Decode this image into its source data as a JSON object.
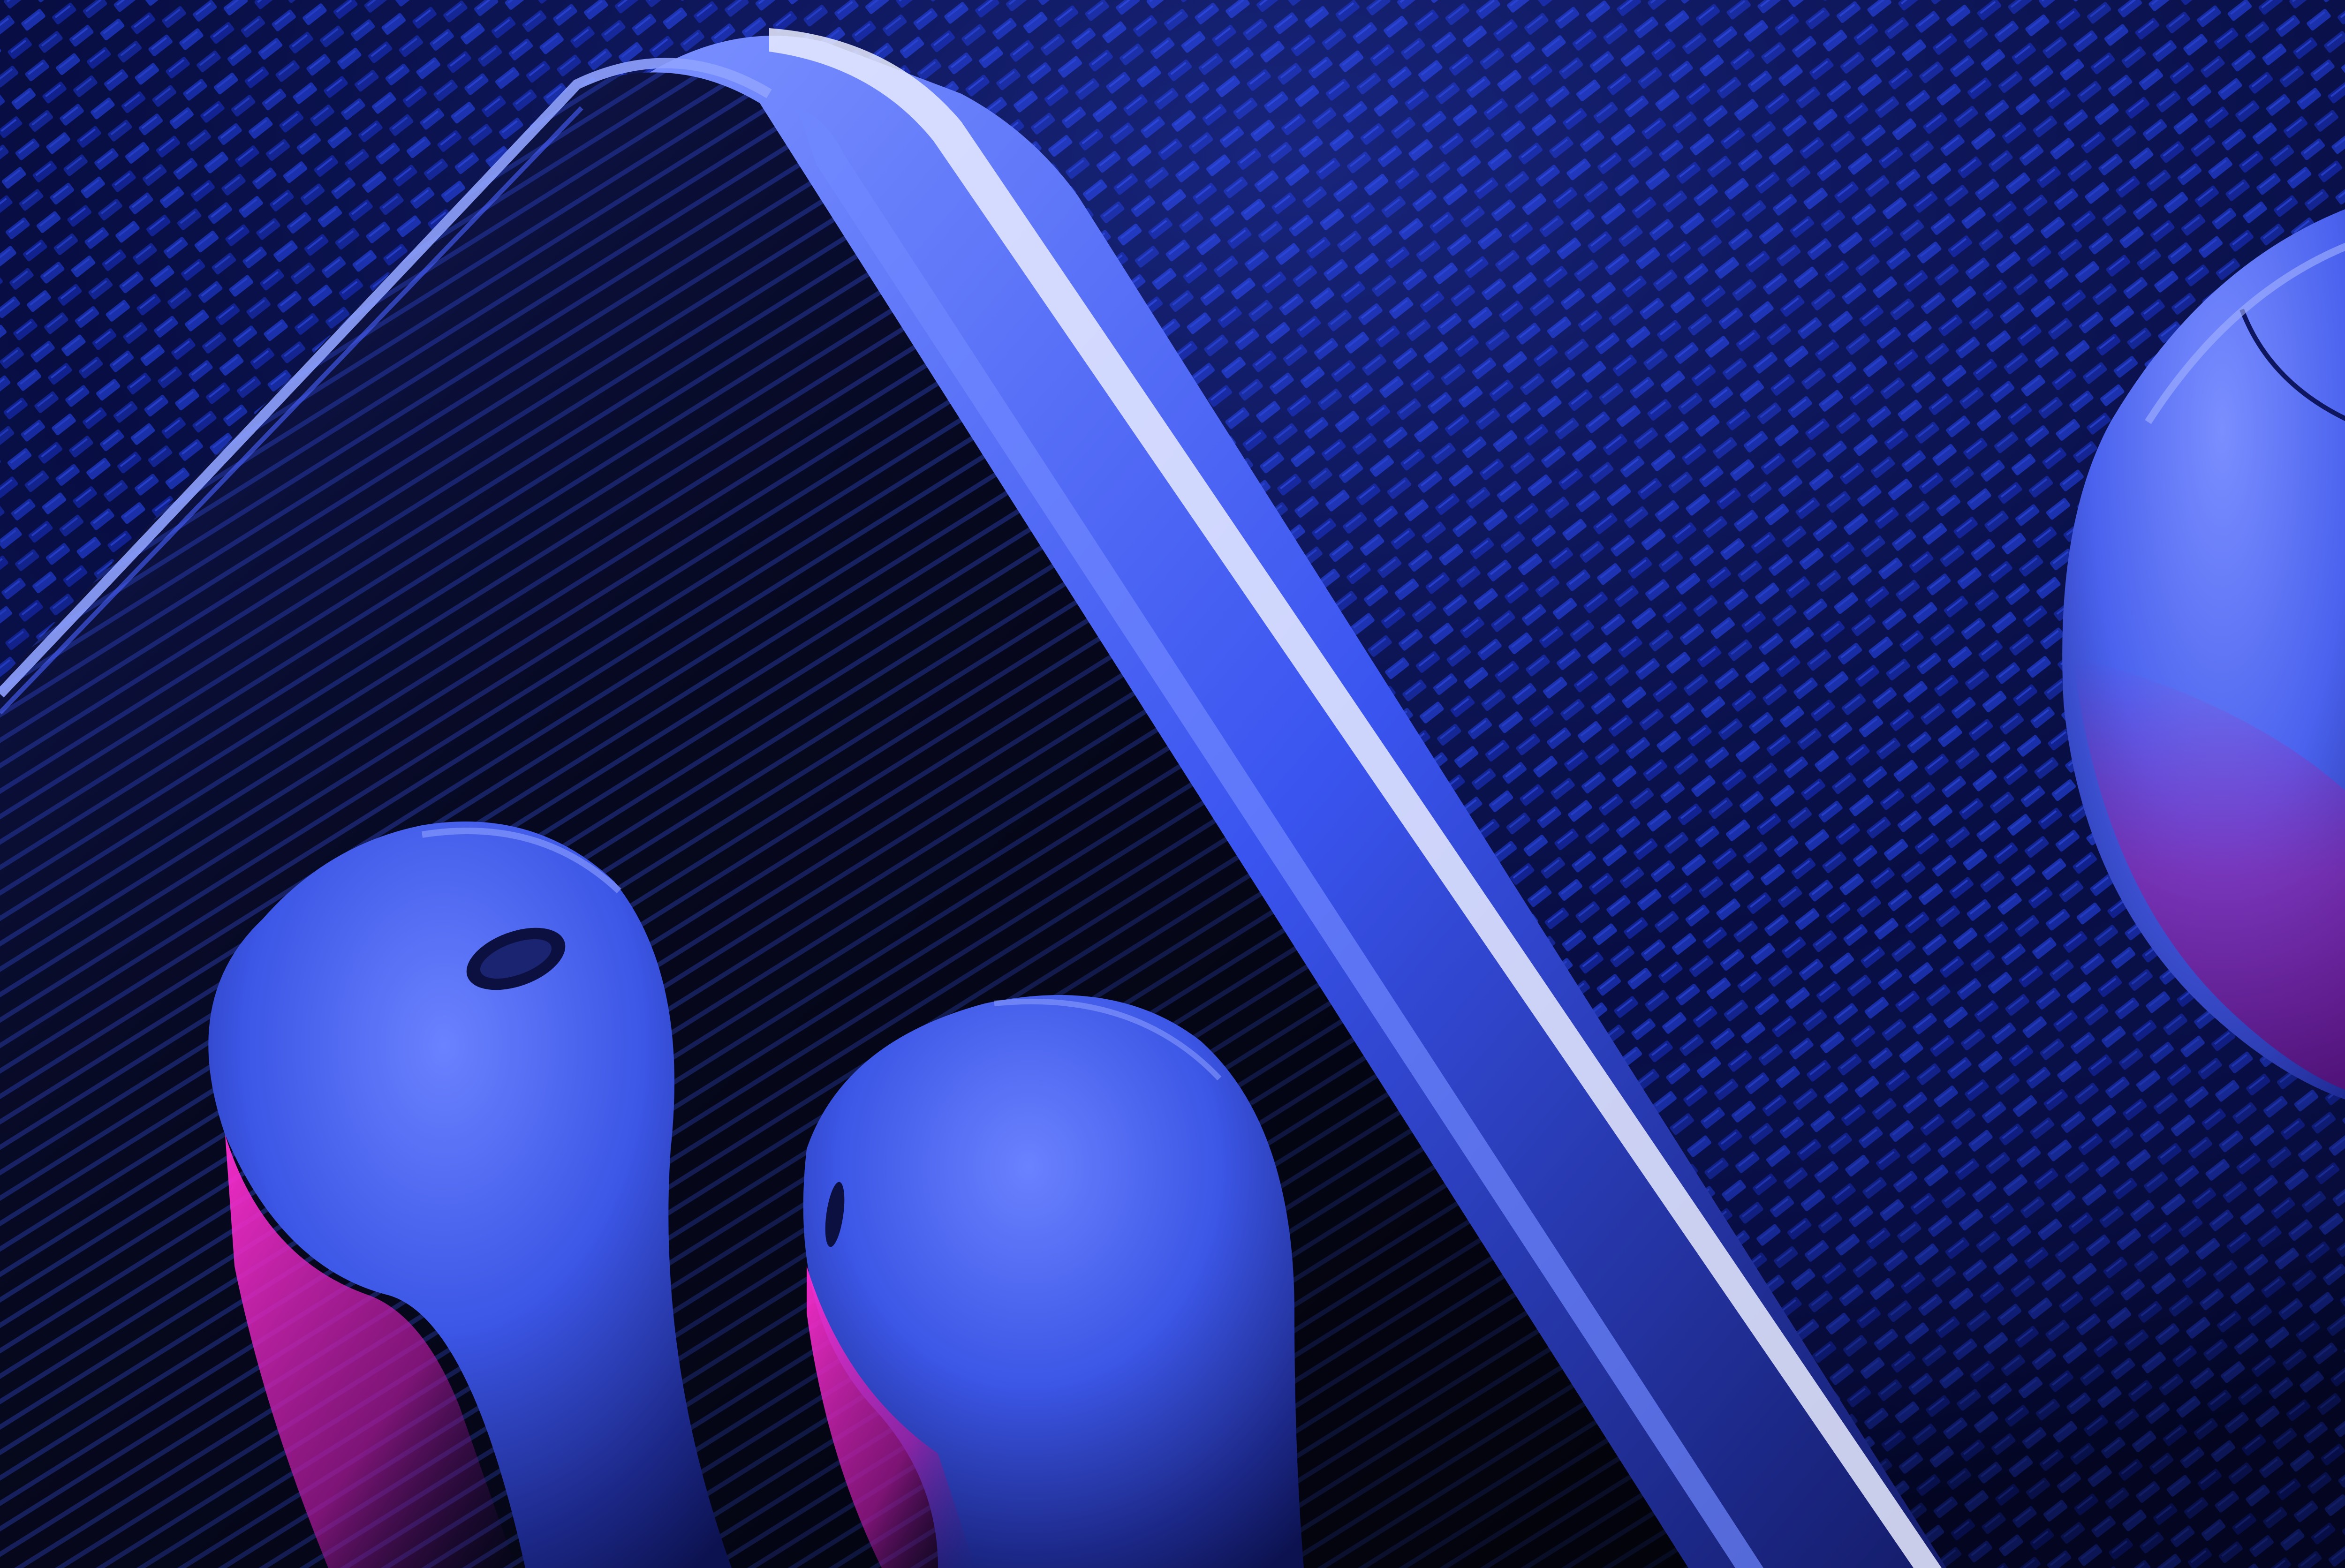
{
  "scene": {
    "subject": "earbuds-on-phone",
    "lighting": {
      "key_light": "#2f46ff",
      "rim_light": "#c81ea8",
      "background": "#05082a"
    },
    "palette": {
      "carbon_fiber_dark": "#070c3a",
      "carbon_fiber_light": "#1c34b0",
      "phone_back": "#080a22",
      "phone_stripe": "#3e56d8",
      "phone_edge": "#5f78ff",
      "edge_highlight": "#e9ecff",
      "earbud_body": "#4460f0",
      "earbud_shadow": "#10165a",
      "earbud_magenta": "#d41fa8",
      "case_body": "#4a64ee"
    },
    "objects": [
      "carbon-fiber-surface",
      "smartphone",
      "left-earbud",
      "right-earbud",
      "charging-case"
    ]
  }
}
